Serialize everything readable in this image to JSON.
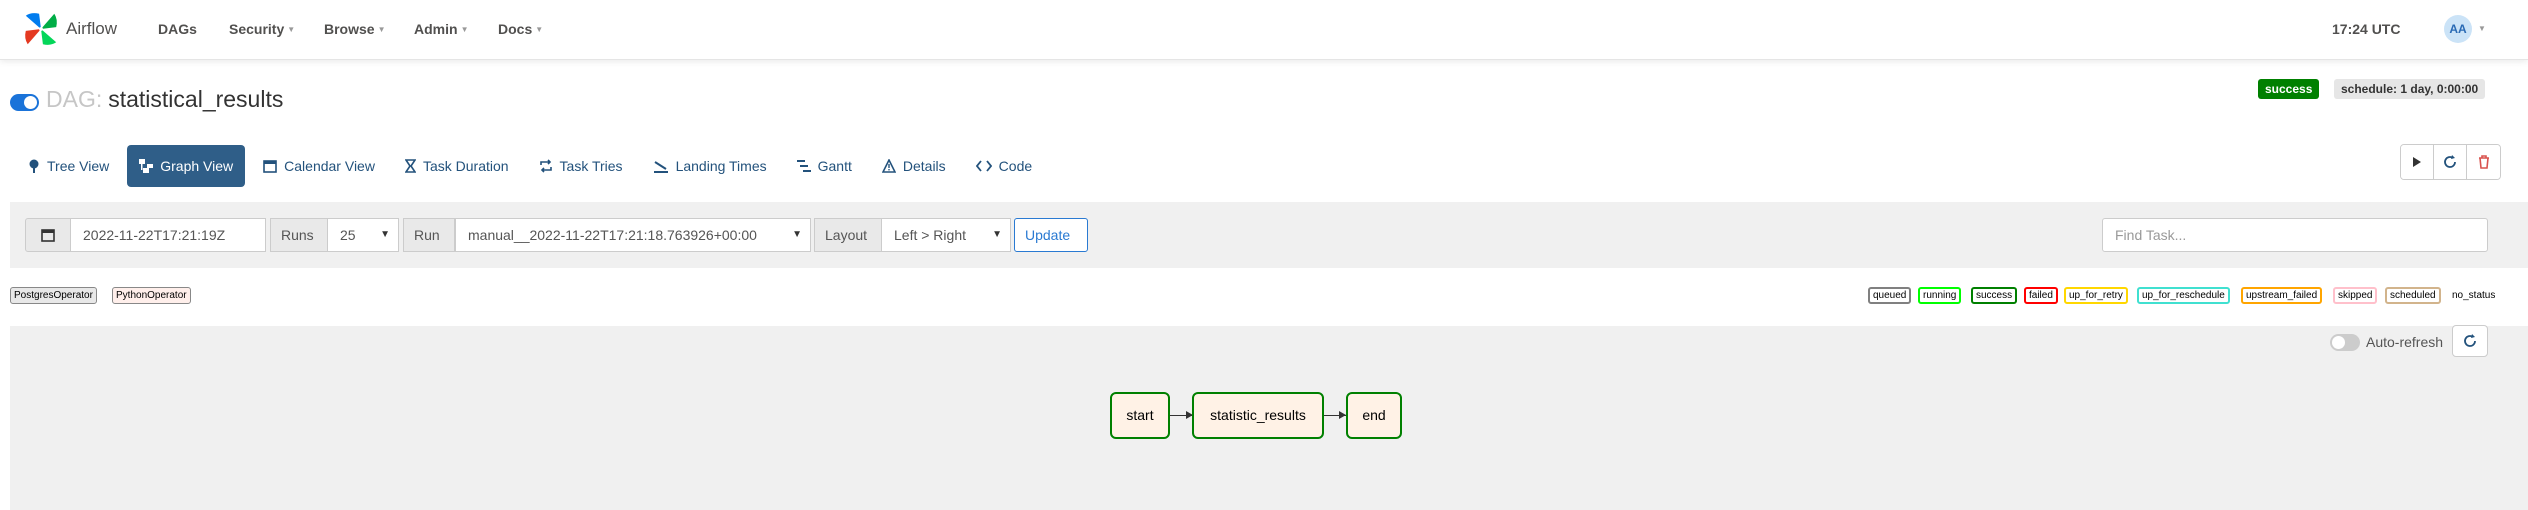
{
  "navbar": {
    "brand": "Airflow",
    "items": [
      {
        "label": "DAGs",
        "has_caret": false
      },
      {
        "label": "Security",
        "has_caret": true
      },
      {
        "label": "Browse",
        "has_caret": true
      },
      {
        "label": "Admin",
        "has_caret": true
      },
      {
        "label": "Docs",
        "has_caret": true
      }
    ],
    "clock": "17:24 UTC",
    "avatar_initials": "AA"
  },
  "dag": {
    "prefix": "DAG:",
    "name": "statistical_results",
    "paused": false,
    "status_badge": "success",
    "schedule_badge": "schedule: 1 day, 0:00:00"
  },
  "tabs": [
    {
      "label": "Tree View",
      "icon": "tree-icon",
      "active": false
    },
    {
      "label": "Graph View",
      "icon": "graph-icon",
      "active": true
    },
    {
      "label": "Calendar View",
      "icon": "calendar-icon",
      "active": false
    },
    {
      "label": "Task Duration",
      "icon": "hourglass-icon",
      "active": false
    },
    {
      "label": "Task Tries",
      "icon": "retry-icon",
      "active": false
    },
    {
      "label": "Landing Times",
      "icon": "landing-icon",
      "active": false
    },
    {
      "label": "Gantt",
      "icon": "gantt-icon",
      "active": false
    },
    {
      "label": "Details",
      "icon": "details-icon",
      "active": false
    },
    {
      "label": "Code",
      "icon": "code-icon",
      "active": false
    }
  ],
  "filters": {
    "base_date": "2022-11-22T17:21:19Z",
    "runs_label": "Runs",
    "runs_value": "25",
    "run_label": "Run",
    "run_value": "manual__2022-11-22T17:21:18.763926+00:00",
    "layout_label": "Layout",
    "layout_value": "Left > Right",
    "update_label": "Update",
    "find_task_placeholder": "Find Task..."
  },
  "operators": [
    {
      "label": "PostgresOperator",
      "color": "#e8e8e8"
    },
    {
      "label": "PythonOperator",
      "color": "#ffefeb"
    }
  ],
  "states": [
    {
      "label": "queued",
      "color": "#808080"
    },
    {
      "label": "running",
      "color": "#00ff00"
    },
    {
      "label": "success",
      "color": "#008000"
    },
    {
      "label": "failed",
      "color": "#ff0000"
    },
    {
      "label": "up_for_retry",
      "color": "#ffd700"
    },
    {
      "label": "up_for_reschedule",
      "color": "#40e0d0"
    },
    {
      "label": "upstream_failed",
      "color": "#ffa500"
    },
    {
      "label": "skipped",
      "color": "#ffc0cb"
    },
    {
      "label": "scheduled",
      "color": "#d2b48c"
    },
    {
      "label": "no_status",
      "color": "#ffffff"
    }
  ],
  "graph": {
    "auto_refresh_label": "Auto-refresh",
    "auto_refresh_on": false,
    "nodes": [
      {
        "label": "start",
        "state": "success"
      },
      {
        "label": "statistic_results",
        "state": "success"
      },
      {
        "label": "end",
        "state": "success"
      }
    ]
  }
}
